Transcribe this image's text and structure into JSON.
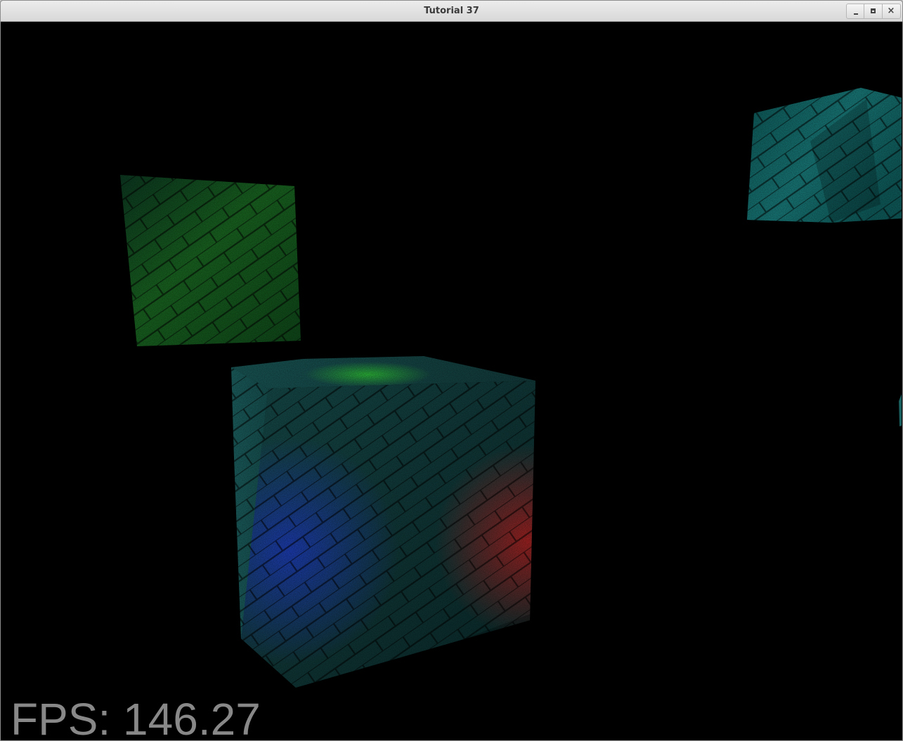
{
  "window": {
    "title": "Tutorial 37"
  },
  "overlay": {
    "fps_text": "FPS: 146.27"
  },
  "icons": {
    "minimize": "minimize-icon",
    "maximize": "maximize-icon",
    "close": "close-icon",
    "close_glyph": "×"
  },
  "scene": {
    "background_color": "#000000",
    "light_colors": [
      "#1d8f2a",
      "#1f3fd0",
      "#c42020",
      "#1f7f7f"
    ]
  }
}
